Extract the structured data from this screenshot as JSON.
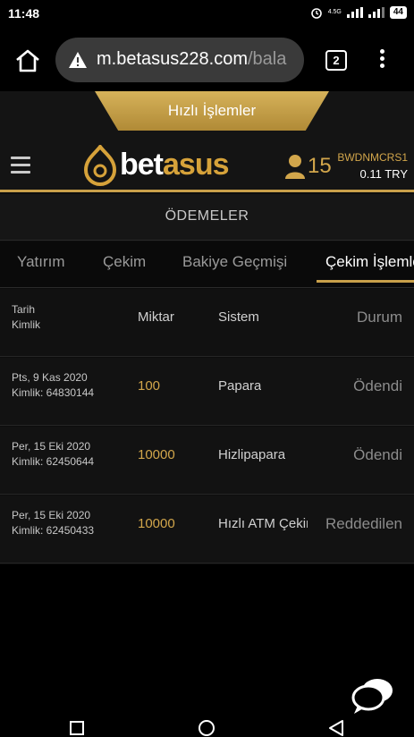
{
  "status_bar": {
    "time": "11:48",
    "network_label": "4.5G",
    "battery": "44"
  },
  "browser": {
    "url_main": "m.betasus228.com",
    "url_dim": "/bala",
    "tab_count": "2"
  },
  "site": {
    "quick_tab_label": "Hızlı İşlemler",
    "logo_text_a": "bet",
    "logo_text_b": "asus",
    "user_count": "15",
    "username": "BWDNMCRS1",
    "balance": "0.11 TRY"
  },
  "page": {
    "title": "ÖDEMELER",
    "tabs": [
      {
        "label": "Yatırım"
      },
      {
        "label": "Çekim"
      },
      {
        "label": "Bakiye Geçmişi"
      },
      {
        "label": "Çekim İşlemleri"
      }
    ],
    "table_header": {
      "date": "Tarih",
      "id": "Kimlik",
      "amount": "Miktar",
      "system": "Sistem",
      "status": "Durum"
    },
    "rows": [
      {
        "date": "Pts, 9 Kas 2020",
        "id": "Kimlik: 64830144",
        "amount": "100",
        "system": "Papara",
        "status": "Ödendi"
      },
      {
        "date": "Per, 15 Eki 2020",
        "id": "Kimlik: 62450644",
        "amount": "10000",
        "system": "Hizlipapara",
        "status": "Ödendi"
      },
      {
        "date": "Per, 15 Eki 2020",
        "id": "Kimlik: 62450433",
        "amount": "10000",
        "system": "Hızlı ATM Çekim",
        "status": "Reddedilen"
      }
    ]
  },
  "colors": {
    "accent_gold": "#c9a04a",
    "background": "#0d0d0d"
  }
}
